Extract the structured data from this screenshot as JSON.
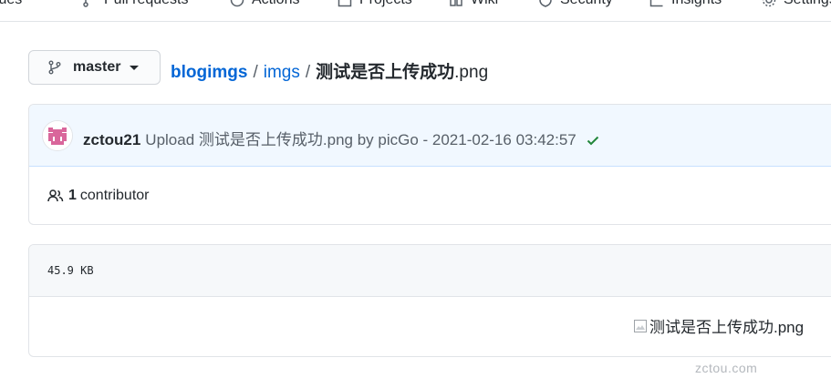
{
  "topnav": {
    "tabs": [
      {
        "label": "Issues",
        "icon": "issue-icon"
      },
      {
        "label": "Pull requests",
        "icon": "pull-request-icon"
      },
      {
        "label": "Actions",
        "icon": "actions-icon"
      },
      {
        "label": "Projects",
        "icon": "projects-icon"
      },
      {
        "label": "Wiki",
        "icon": "wiki-icon"
      },
      {
        "label": "Security",
        "icon": "shield-icon"
      },
      {
        "label": "Insights",
        "icon": "graph-icon"
      },
      {
        "label": "Settings",
        "icon": "gear-icon"
      }
    ]
  },
  "branch": {
    "label": "master"
  },
  "breadcrumb": {
    "repo": "blogimgs",
    "sep1": "/",
    "folder": "imgs",
    "sep2": "/",
    "filename": "测试是否上传成功",
    "ext": ".png"
  },
  "commit": {
    "author": "zctou21",
    "message": "Upload 测试是否上传成功.png by picGo - 2021-02-16 03:42:57",
    "status_color": "#22863a"
  },
  "contributors": {
    "count": "1",
    "label": "contributor"
  },
  "file": {
    "size": "45.9 KB",
    "image_alt": "测试是否上传成功.png"
  },
  "watermark": "zctou.com"
}
